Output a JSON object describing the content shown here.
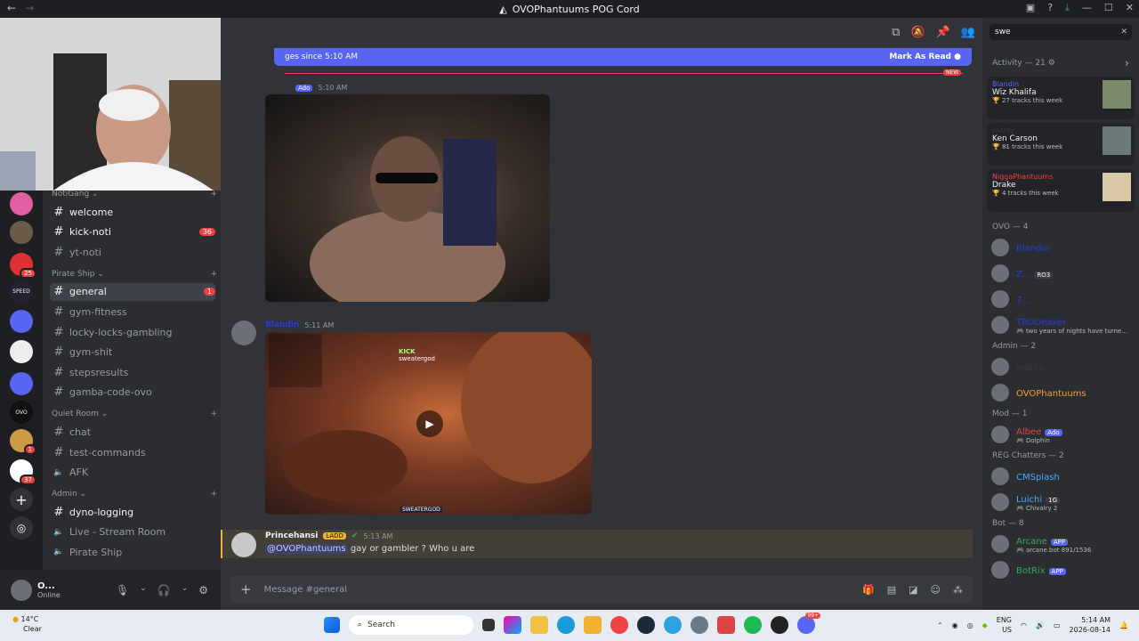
{
  "window": {
    "title": "OVOPhantuums POG Cord",
    "back_icon": "←",
    "forward_icon": "→"
  },
  "servers": [
    {
      "badge": ""
    },
    {
      "badge": ""
    },
    {
      "badge": "25"
    },
    {
      "label": "SPEED",
      "badge": ""
    },
    {
      "badge": ""
    },
    {
      "badge": ""
    },
    {
      "badge": ""
    },
    {
      "label": "OVO",
      "badge": ""
    },
    {
      "badge": "1"
    },
    {
      "badge": "37"
    }
  ],
  "channels": {
    "categories": [
      {
        "name": "NotiGang",
        "channels": [
          {
            "name": "welcome",
            "unread": true
          },
          {
            "name": "kick-noti",
            "unread": true,
            "count": "36"
          },
          {
            "name": "yt-noti"
          }
        ]
      },
      {
        "name": "Pirate Ship",
        "channels": [
          {
            "name": "general",
            "active": true,
            "count": "1"
          },
          {
            "name": "gym-fitness"
          },
          {
            "name": "locky-locks-gambling"
          },
          {
            "name": "gym-shit"
          },
          {
            "name": "stepsresults"
          },
          {
            "name": "gamba-code-ovo"
          }
        ]
      },
      {
        "name": "Quiet Room",
        "channels": [
          {
            "name": "chat"
          },
          {
            "name": "test-commands"
          },
          {
            "name": "AFK",
            "voice": true
          }
        ]
      },
      {
        "name": "Admin",
        "channels": [
          {
            "name": "dyno-logging",
            "unread": true
          },
          {
            "name": "Live - Stream Room",
            "voice": true
          },
          {
            "name": "Pirate Ship",
            "voice": true
          }
        ]
      }
    ]
  },
  "user": {
    "name": "O...",
    "status": "Online"
  },
  "banner": {
    "text": "ges since 5:10 AM",
    "action": "Mark As Read"
  },
  "new_tag": "NEW",
  "messages": [
    {
      "tag": "Ado",
      "time": "5:10 AM"
    },
    {
      "author": "Blandin",
      "time": "5:11 AM",
      "overlay": "KICK",
      "overlay_sub": "sweatergod",
      "watermark": "SWEATERGOD"
    },
    {
      "author": "Princehansi",
      "tag": "LADD",
      "time": "5:13 AM",
      "mention": "@OVOPhantuums",
      "text": "gay or gambler ? Who u are"
    }
  ],
  "composer": {
    "placeholder": "Message #general"
  },
  "members": {
    "search": "swe",
    "activity_header": "Activity — 21",
    "activity": [
      {
        "user": "Blandin",
        "artist": "Wiz Khalifa",
        "detail": "27 tracks this week"
      },
      {
        "user": "marky",
        "artist": "Ken Carson",
        "detail": "81 tracks this week"
      },
      {
        "user": "NiggaPhantuums",
        "artist": "Drake",
        "detail": "4 tracks this week"
      }
    ],
    "groups": [
      {
        "name": "OVO — 4",
        "members": [
          {
            "name": "Blandin",
            "color": "#2b3bd4"
          },
          {
            "name": "Z...",
            "color": "#2b3bd4",
            "tag": "RO3"
          },
          {
            "name": "7...",
            "color": "#2b3bd4"
          },
          {
            "name": "TBODeaker",
            "color": "#2b3bd4",
            "sub": "two years of nights have turne..."
          }
        ]
      },
      {
        "name": "Admin — 2",
        "members": [
          {
            "name": "marky",
            "color": "#3a3a3a"
          },
          {
            "name": "OVOPhantuums",
            "color": "#f0a035"
          }
        ]
      },
      {
        "name": "Mod — 1",
        "members": [
          {
            "name": "Albee",
            "color": "#f23f42",
            "tag": "Ado",
            "sub": "Dolphin"
          }
        ]
      },
      {
        "name": "REG Chatters — 2",
        "members": [
          {
            "name": "CMSplash",
            "color": "#4aa8ff"
          },
          {
            "name": "Luichi",
            "color": "#4aa8ff",
            "tag": "1G",
            "sub": "Chivalry 2"
          }
        ]
      },
      {
        "name": "Bot — 8",
        "members": [
          {
            "name": "Arcane",
            "color": "#3ba55d",
            "tag": "APP",
            "sub": "arcane.bot 891/1536"
          },
          {
            "name": "BotRix",
            "color": "#3ba55d",
            "tag": "APP"
          }
        ]
      }
    ]
  },
  "taskbar": {
    "temp": "14°C",
    "weather": "Clear",
    "search": "Search",
    "lang": "ENG",
    "region": "US",
    "time": "5:14 AM",
    "date": "2026-08-14",
    "discord_badge": "99+"
  }
}
